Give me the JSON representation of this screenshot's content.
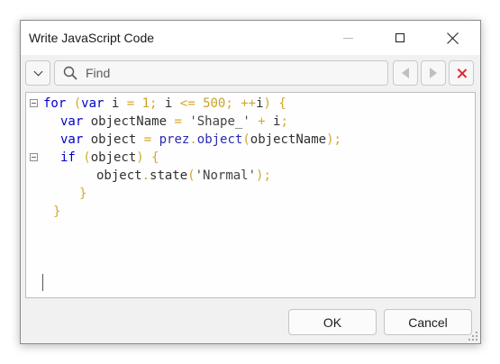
{
  "window": {
    "title": "Write JavaScript Code"
  },
  "search": {
    "placeholder": "Find",
    "value": ""
  },
  "icons": {
    "dropdown": "chevron-down-icon",
    "search": "magnifier-icon",
    "prev": "previous-icon",
    "next": "next-icon",
    "clear": "clear-x-icon"
  },
  "colors": {
    "keyword": "#0000cc",
    "clear_icon": "#d9292e",
    "punctuation": "#d4a82d"
  },
  "code": {
    "l1": {
      "kw": "for",
      "p1": " (",
      "kw2": "var",
      "id1": " i ",
      "op1": "=",
      "num1": " 1",
      "p2": ";",
      "id2": " i ",
      "op2": "<=",
      "num2": " 500",
      "p3": ";",
      "op3": " ++",
      "id3": "i",
      "p4": ") {"
    },
    "l2": {
      "kw": "var",
      "id1": " objectName ",
      "op1": "=",
      "str": " 'Shape_'",
      "op2": " +",
      "id2": " i",
      "p1": ";"
    },
    "l3": {
      "kw": "var",
      "id1": " object ",
      "op1": "=",
      "fn": " prez",
      "p1": ".",
      "fn2": "object",
      "p2": "(",
      "id2": "objectName",
      "p3": ");"
    },
    "l4": {
      "kw": "if",
      "p1": " (",
      "id1": "object",
      "p2": ") {"
    },
    "l5": {
      "id1": "object",
      "p1": ".",
      "id2": "state",
      "p2": "(",
      "str": "'Normal'",
      "p3": ");"
    },
    "l6": {
      "p1": "}"
    },
    "l7": {
      "p1": "}"
    }
  },
  "buttons": {
    "ok": "OK",
    "cancel": "Cancel"
  }
}
